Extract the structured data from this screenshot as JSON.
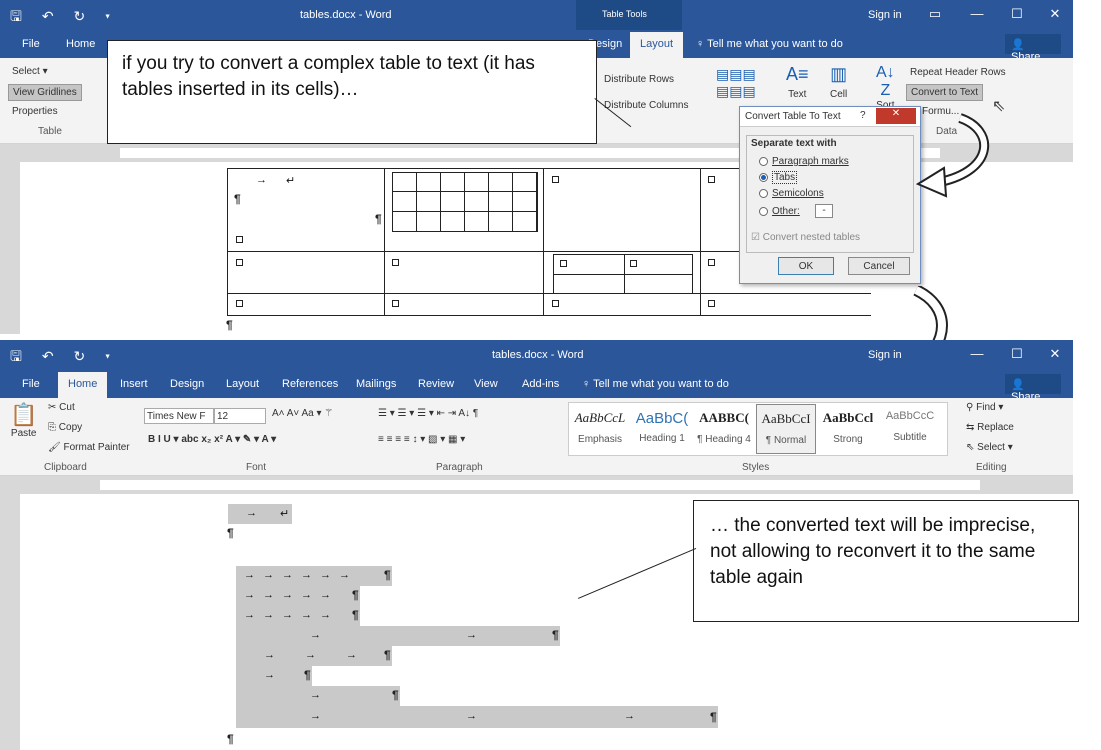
{
  "top": {
    "window_title": "tables.docx - Word",
    "context_group": "Table Tools",
    "signin": "Sign in",
    "tabs": [
      "File",
      "Home",
      "Design",
      "Layout"
    ],
    "tell_me": "Tell me what you want to do",
    "share": "Share",
    "ribbon": {
      "select": "Select ▾",
      "view_gridlines": "View Gridlines",
      "properties": "Properties",
      "table_group": "Table",
      "distribute_rows": "Distribute Rows",
      "distribute_columns": "Distribute Columns",
      "repeat_header_rows": "Repeat Header Rows",
      "convert_to_text": "Convert to Text",
      "formula": "Formu...",
      "data_group": "Data",
      "text_dir": "Text",
      "cell": "Cell",
      "sort": "Sort"
    }
  },
  "dialog": {
    "title": "Convert Table To Text",
    "section": "Separate text with",
    "options": [
      "Paragraph marks",
      "Tabs",
      "Semicolons",
      "Other:"
    ],
    "selected": "Tabs",
    "other_value": "-",
    "nested": "Convert nested tables",
    "ok": "OK",
    "cancel": "Cancel"
  },
  "callouts": {
    "top": "if you try to convert a complex table to text (it has tables inserted in its cells)…",
    "bottom": "… the converted text will be imprecise, not allowing to reconvert it  to the same table again"
  },
  "bottom": {
    "window_title": "tables.docx - Word",
    "signin": "Sign in",
    "tabs": [
      "File",
      "Home",
      "Insert",
      "Design",
      "Layout",
      "References",
      "Mailings",
      "Review",
      "View",
      "Add-ins"
    ],
    "tell_me": "Tell me what you want to do",
    "share": "Share",
    "clipboard": {
      "paste": "Paste",
      "cut": "Cut",
      "copy": "Copy",
      "format_painter": "Format Painter",
      "label": "Clipboard"
    },
    "font": {
      "name": "Times New F",
      "size": "12",
      "label": "Font"
    },
    "paragraph_label": "Paragraph",
    "styles": [
      {
        "sample": "AaBbCcL",
        "name": "Emphasis"
      },
      {
        "sample": "AaBbC(",
        "name": "Heading 1"
      },
      {
        "sample": "AABBC(",
        "name": "¶ Heading 4"
      },
      {
        "sample": "AaBbCcI",
        "name": "¶ Normal"
      },
      {
        "sample": "AaBbCcl",
        "name": "Strong"
      },
      {
        "sample": "AaBbCcC",
        "name": "Subtitle"
      }
    ],
    "styles_label": "Styles",
    "editing": {
      "find": "Find ▾",
      "replace": "Replace",
      "select": "Select ▾",
      "label": "Editing"
    }
  },
  "colors": {
    "word_blue": "#2b579a",
    "ribbon_bg": "#f3f3f3",
    "highlight": "#c9c9c9"
  }
}
